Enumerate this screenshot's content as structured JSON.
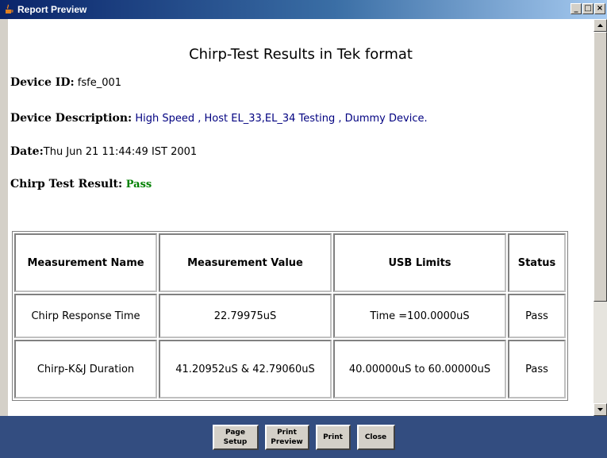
{
  "window": {
    "title": "Report Preview",
    "controls": {
      "minimize": "_",
      "maximize": "□",
      "close": "×"
    }
  },
  "report": {
    "title": "Chirp-Test Results in Tek format",
    "device_id_label": "Device ID:",
    "device_id_value": " fsfe_001",
    "device_description_label": "Device Description:",
    "device_description_value": " High Speed , Host EL_33,EL_34 Testing , Dummy Device.",
    "date_label": "Date:",
    "date_value": "Thu Jun 21 11:44:49 IST 2001",
    "result_label": "Chirp Test Result:",
    "result_value": " Pass",
    "pass_color": "#008000"
  },
  "table": {
    "headers": [
      "Measurement Name",
      "Measurement Value",
      "USB Limits",
      "Status"
    ],
    "rows": [
      {
        "name": "Chirp Response Time",
        "value": "22.79975uS",
        "limits": "Time =100.0000uS",
        "status": "Pass"
      },
      {
        "name": "Chirp-K&J Duration",
        "value": "41.20952uS & 42.79060uS",
        "limits": "40.00000uS to 60.00000uS",
        "status": "Pass"
      }
    ]
  },
  "buttons": {
    "page_setup": "Page\nSetup",
    "print_preview": "Print\nPreview",
    "print": "Print",
    "close": "Close"
  },
  "colors": {
    "bottom_panel": "#334d80",
    "titlebar_start": "#0a246a",
    "description_value": "#000080"
  }
}
